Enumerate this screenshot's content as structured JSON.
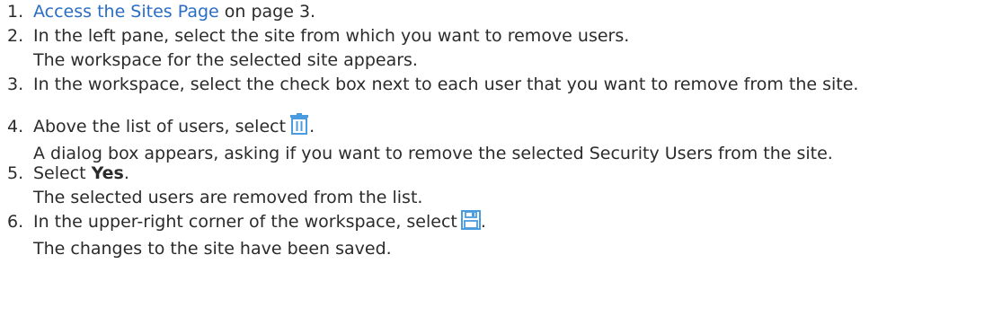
{
  "steps": [
    {
      "number": "1.",
      "link_text": "Access the Sites Page",
      "text_after_link": " on page 3."
    },
    {
      "number": "2.",
      "text": "In the left pane, select the site from which you want to remove users.",
      "result": "The workspace for the selected site appears."
    },
    {
      "number": "3.",
      "text": "In the workspace, select the check box next to each user that you want to remove from the site."
    },
    {
      "number": "4.",
      "text_before_icon": "Above the list of users, select",
      "icon": "trash-icon",
      "text_after_icon": ".",
      "result": "A dialog box appears, asking if you want to remove the selected Security Users from the site."
    },
    {
      "number": "5.",
      "text_before_bold": "Select ",
      "bold": "Yes",
      "text_after_bold": ".",
      "result": "The selected users are removed from the list."
    },
    {
      "number": "6.",
      "text_before_icon": "In the upper-right corner of the workspace, select",
      "icon": "save-icon",
      "text_after_icon": ".",
      "result": "The changes to the site have been saved."
    }
  ],
  "colors": {
    "text": "#2b2b2b",
    "link": "#2a6dc4",
    "icon": "#4a9be0"
  }
}
